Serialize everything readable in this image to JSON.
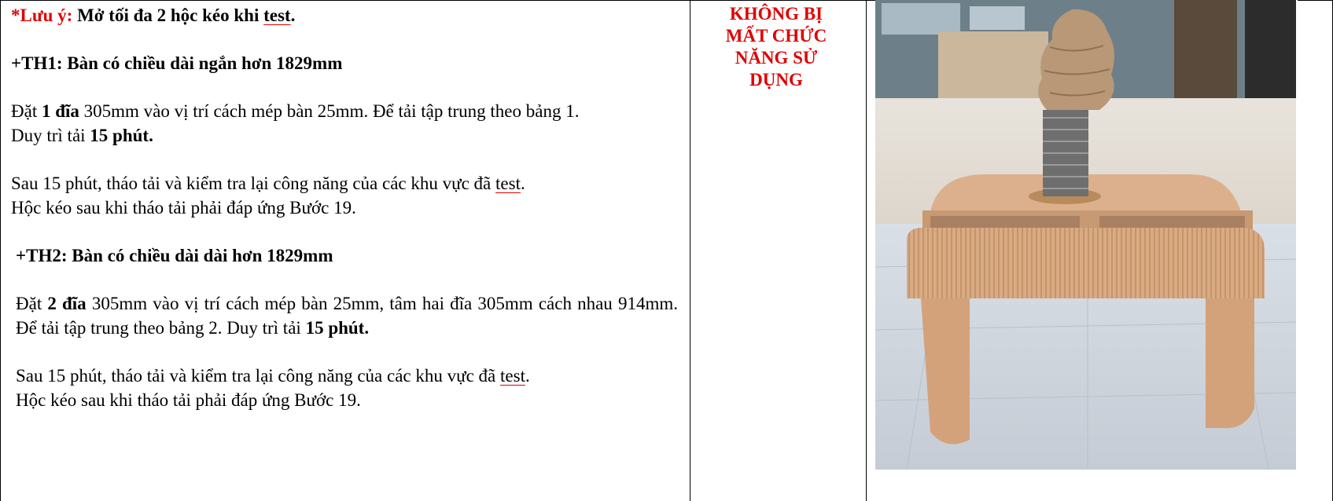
{
  "col1": {
    "note_prefix": "*Lưu ý:",
    "note_text": " Mở tối đa 2 hộc kéo khi ",
    "note_test": "test",
    "note_end": ".",
    "th1_heading": "+TH1: Bàn có chiều dài ngắn hơn 1829mm",
    "th1_p1_a": "Đặt ",
    "th1_p1_b": "1 đĩa",
    "th1_p1_c": " 305mm vào vị trí cách mép bàn 25mm. Để tải tập trung theo bảng 1.",
    "th1_p1_d": "Duy trì tải ",
    "th1_p1_e": "15 phút.",
    "th1_p2_a": "Sau 15 phút, tháo tải và kiểm tra lại công năng của các khu vực đã ",
    "th1_p2_test": "test",
    "th1_p2_b": ".",
    "th1_p2_c": "Hộc kéo sau khi tháo tải phải đáp ứng Bước 19.",
    "th2_heading": "+TH2: Bàn có chiều dài dài hơn 1829mm",
    "th2_p1_a": "Đặt ",
    "th2_p1_b": "2 đĩa",
    "th2_p1_c": " 305mm vào vị trí cách mép bàn 25mm, tâm hai đĩa 305mm cách nhau 914mm. Để tải tập trung theo bảng 2. Duy trì tải ",
    "th2_p1_d": "15 phút.",
    "th2_p2_a": "Sau 15 phút, tháo tải và kiểm tra lại công năng của các khu vực đã ",
    "th2_p2_test": "test",
    "th2_p2_b": ".",
    "th2_p2_c": "Hộc kéo sau khi tháo tải phải đáp ứng Bước 19."
  },
  "col2": {
    "result_lines": [
      "KHÔNG BỊ",
      "MẤT CHỨC",
      "NĂNG SỬ",
      "DỤNG"
    ]
  },
  "colors": {
    "red": "#e00000",
    "wood": "#d7a77e"
  }
}
